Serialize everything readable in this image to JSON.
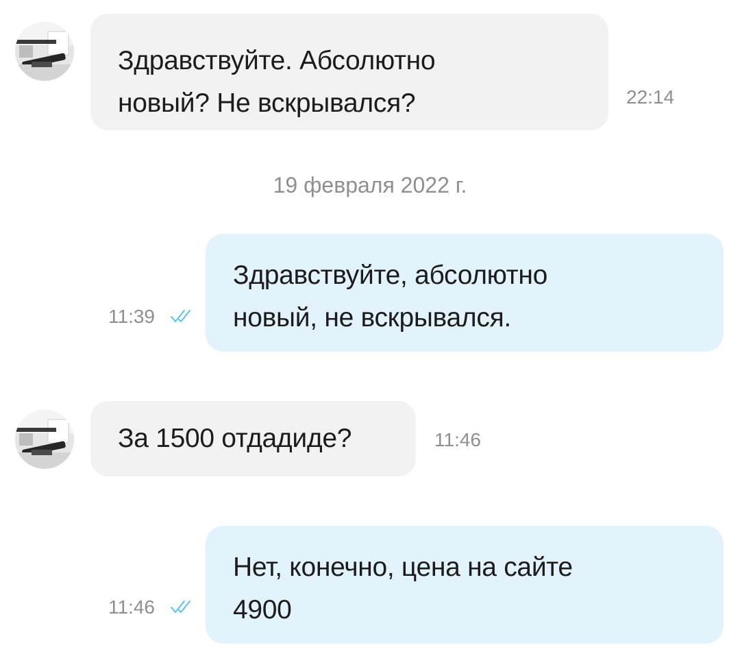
{
  "messages": [
    {
      "direction": "incoming",
      "text": "Здравствуйте. Абсолютно\nновый? Не вскрывался?",
      "time": "22:14",
      "avatar_icon": "user-avatar-photo"
    },
    {
      "direction": "outgoing",
      "text": "Здравствуйте, абсолютно\nновый, не вскрывался.",
      "time": "11:39",
      "status_icon": "double-check-read-icon"
    },
    {
      "direction": "incoming",
      "text": "За 1500 отдадиде?",
      "time": "11:46",
      "avatar_icon": "user-avatar-photo"
    },
    {
      "direction": "outgoing",
      "text": "Нет, конечно, цена на сайте\n4900",
      "time": "11:46",
      "status_icon": "double-check-read-icon"
    }
  ],
  "date_separator": "19 февраля 2022 г.",
  "colors": {
    "incoming_bubble": "#f2f2f2",
    "outgoing_bubble": "#e3f3fc",
    "read_check": "#5bc4ee",
    "muted_text": "#8f8f8f"
  }
}
